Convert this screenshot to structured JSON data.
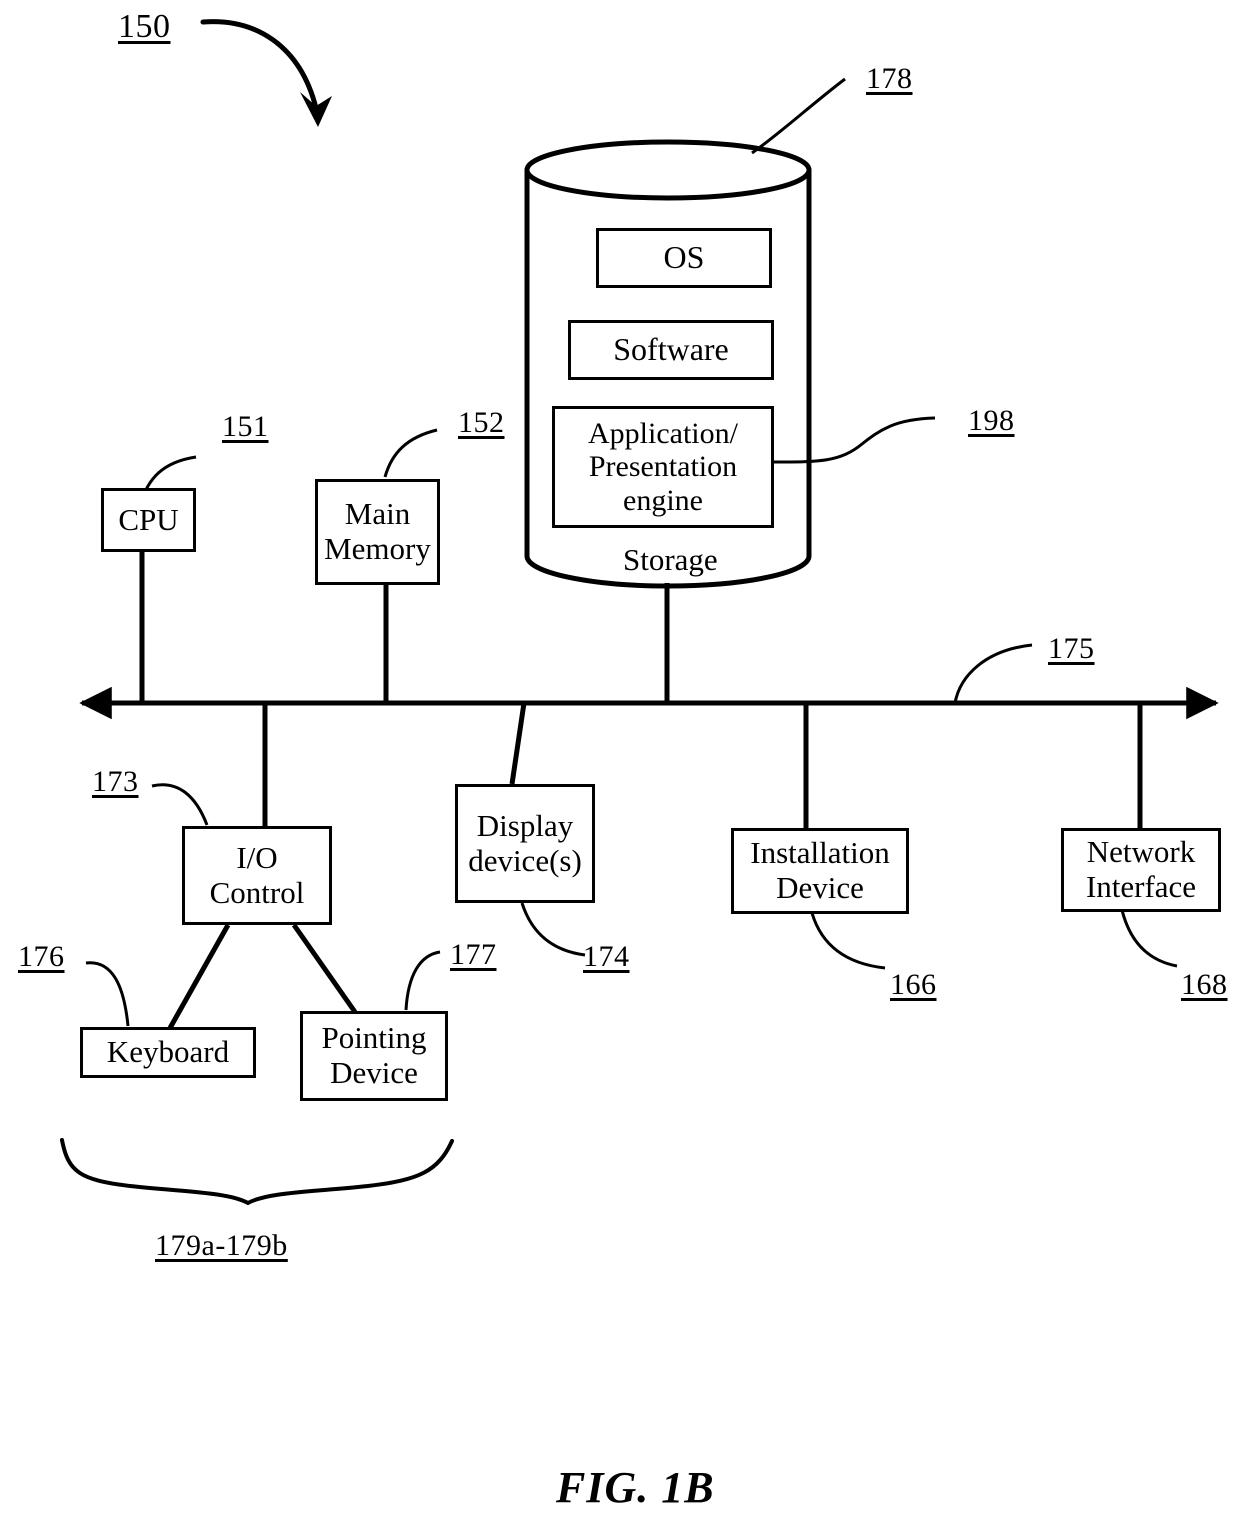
{
  "figure": {
    "caption": "FIG. 1B",
    "diagram_ref": "150"
  },
  "storage": {
    "cylinder_label": "Storage",
    "cylinder_ref": "178",
    "inner_boxes": [
      {
        "label": "OS"
      },
      {
        "label": "Software"
      },
      {
        "label": "Application/\nPresentation\nengine",
        "ref": "198"
      }
    ]
  },
  "components": [
    {
      "label": "CPU",
      "ref": "151"
    },
    {
      "label": "Main\nMemory",
      "ref": "152"
    },
    {
      "label": "I/O\nControl",
      "ref": "173"
    },
    {
      "label": "Display\ndevice(s)",
      "ref": "174"
    },
    {
      "label": "Installation\nDevice",
      "ref": "166"
    },
    {
      "label": "Network\nInterface",
      "ref": "168"
    },
    {
      "label": "Keyboard",
      "ref": "176"
    },
    {
      "label": "Pointing\nDevice",
      "ref": "177"
    }
  ],
  "bus": {
    "ref": "175"
  },
  "io_devices_group": {
    "ref": "179a-179b"
  }
}
